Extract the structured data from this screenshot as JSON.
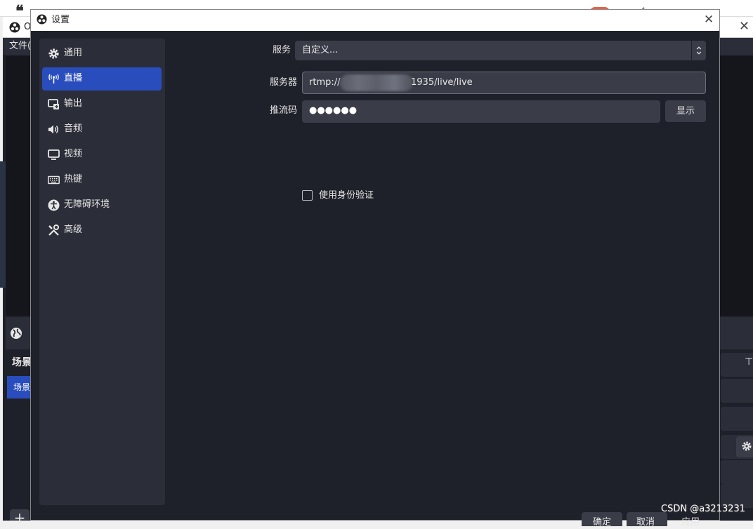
{
  "background": {
    "main_window_title": "O",
    "menu_file": "文件(",
    "scenes_title": "场景",
    "scene_item": "场景"
  },
  "dialog": {
    "title": "设置"
  },
  "sidebar": {
    "items": [
      {
        "label": "通用",
        "icon": "gear-icon"
      },
      {
        "label": "直播",
        "icon": "antenna-icon",
        "active": true
      },
      {
        "label": "输出",
        "icon": "output-icon"
      },
      {
        "label": "音频",
        "icon": "speaker-icon"
      },
      {
        "label": "视频",
        "icon": "monitor-icon"
      },
      {
        "label": "热键",
        "icon": "keyboard-icon"
      },
      {
        "label": "无障碍环境",
        "icon": "accessibility-icon"
      },
      {
        "label": "高级",
        "icon": "tools-icon"
      }
    ]
  },
  "stream": {
    "service_label": "服务",
    "service_value": "自定义...",
    "server_label": "服务器",
    "server_value_prefix": "rtmp://",
    "server_value_suffix": "1935/live/live",
    "key_label": "推流码",
    "key_value": "●●●●●●",
    "show_button": "显示",
    "auth_label": "使用身份验证",
    "auth_checked": false
  },
  "footer": {
    "ok": "确定",
    "cancel": "取消",
    "apply": "应用"
  },
  "watermark": "CSDN @a3213231",
  "colors": {
    "accent": "#2a4dbd",
    "dialog_bg": "#1f212a",
    "panel_bg": "#2b2e38",
    "input_bg": "#3a3d48"
  }
}
